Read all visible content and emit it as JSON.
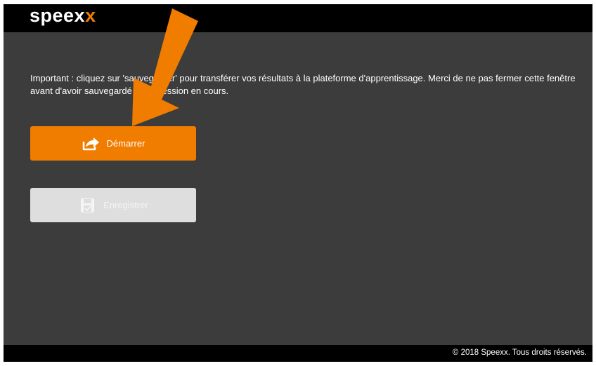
{
  "brand": {
    "name_main": "speex",
    "name_accent": "x",
    "accent_color": "#f07c00"
  },
  "message": "Important : cliquez sur 'sauvegarder' pour transférer vos résultats à la plateforme d'apprentissage. Merci de ne pas fermer cette fenêtre avant d'avoir sauvegardé votre session en cours.",
  "buttons": {
    "start": {
      "label": "Démarrer",
      "icon": "share-arrow-icon"
    },
    "save": {
      "label": "Enregistrer",
      "icon": "save-disk-icon"
    }
  },
  "footer": {
    "copyright": "© 2018 Speexx. Tous droits réservés."
  },
  "annotation": {
    "arrow_color": "#f07c00",
    "icon": "pointer-arrow-icon"
  }
}
